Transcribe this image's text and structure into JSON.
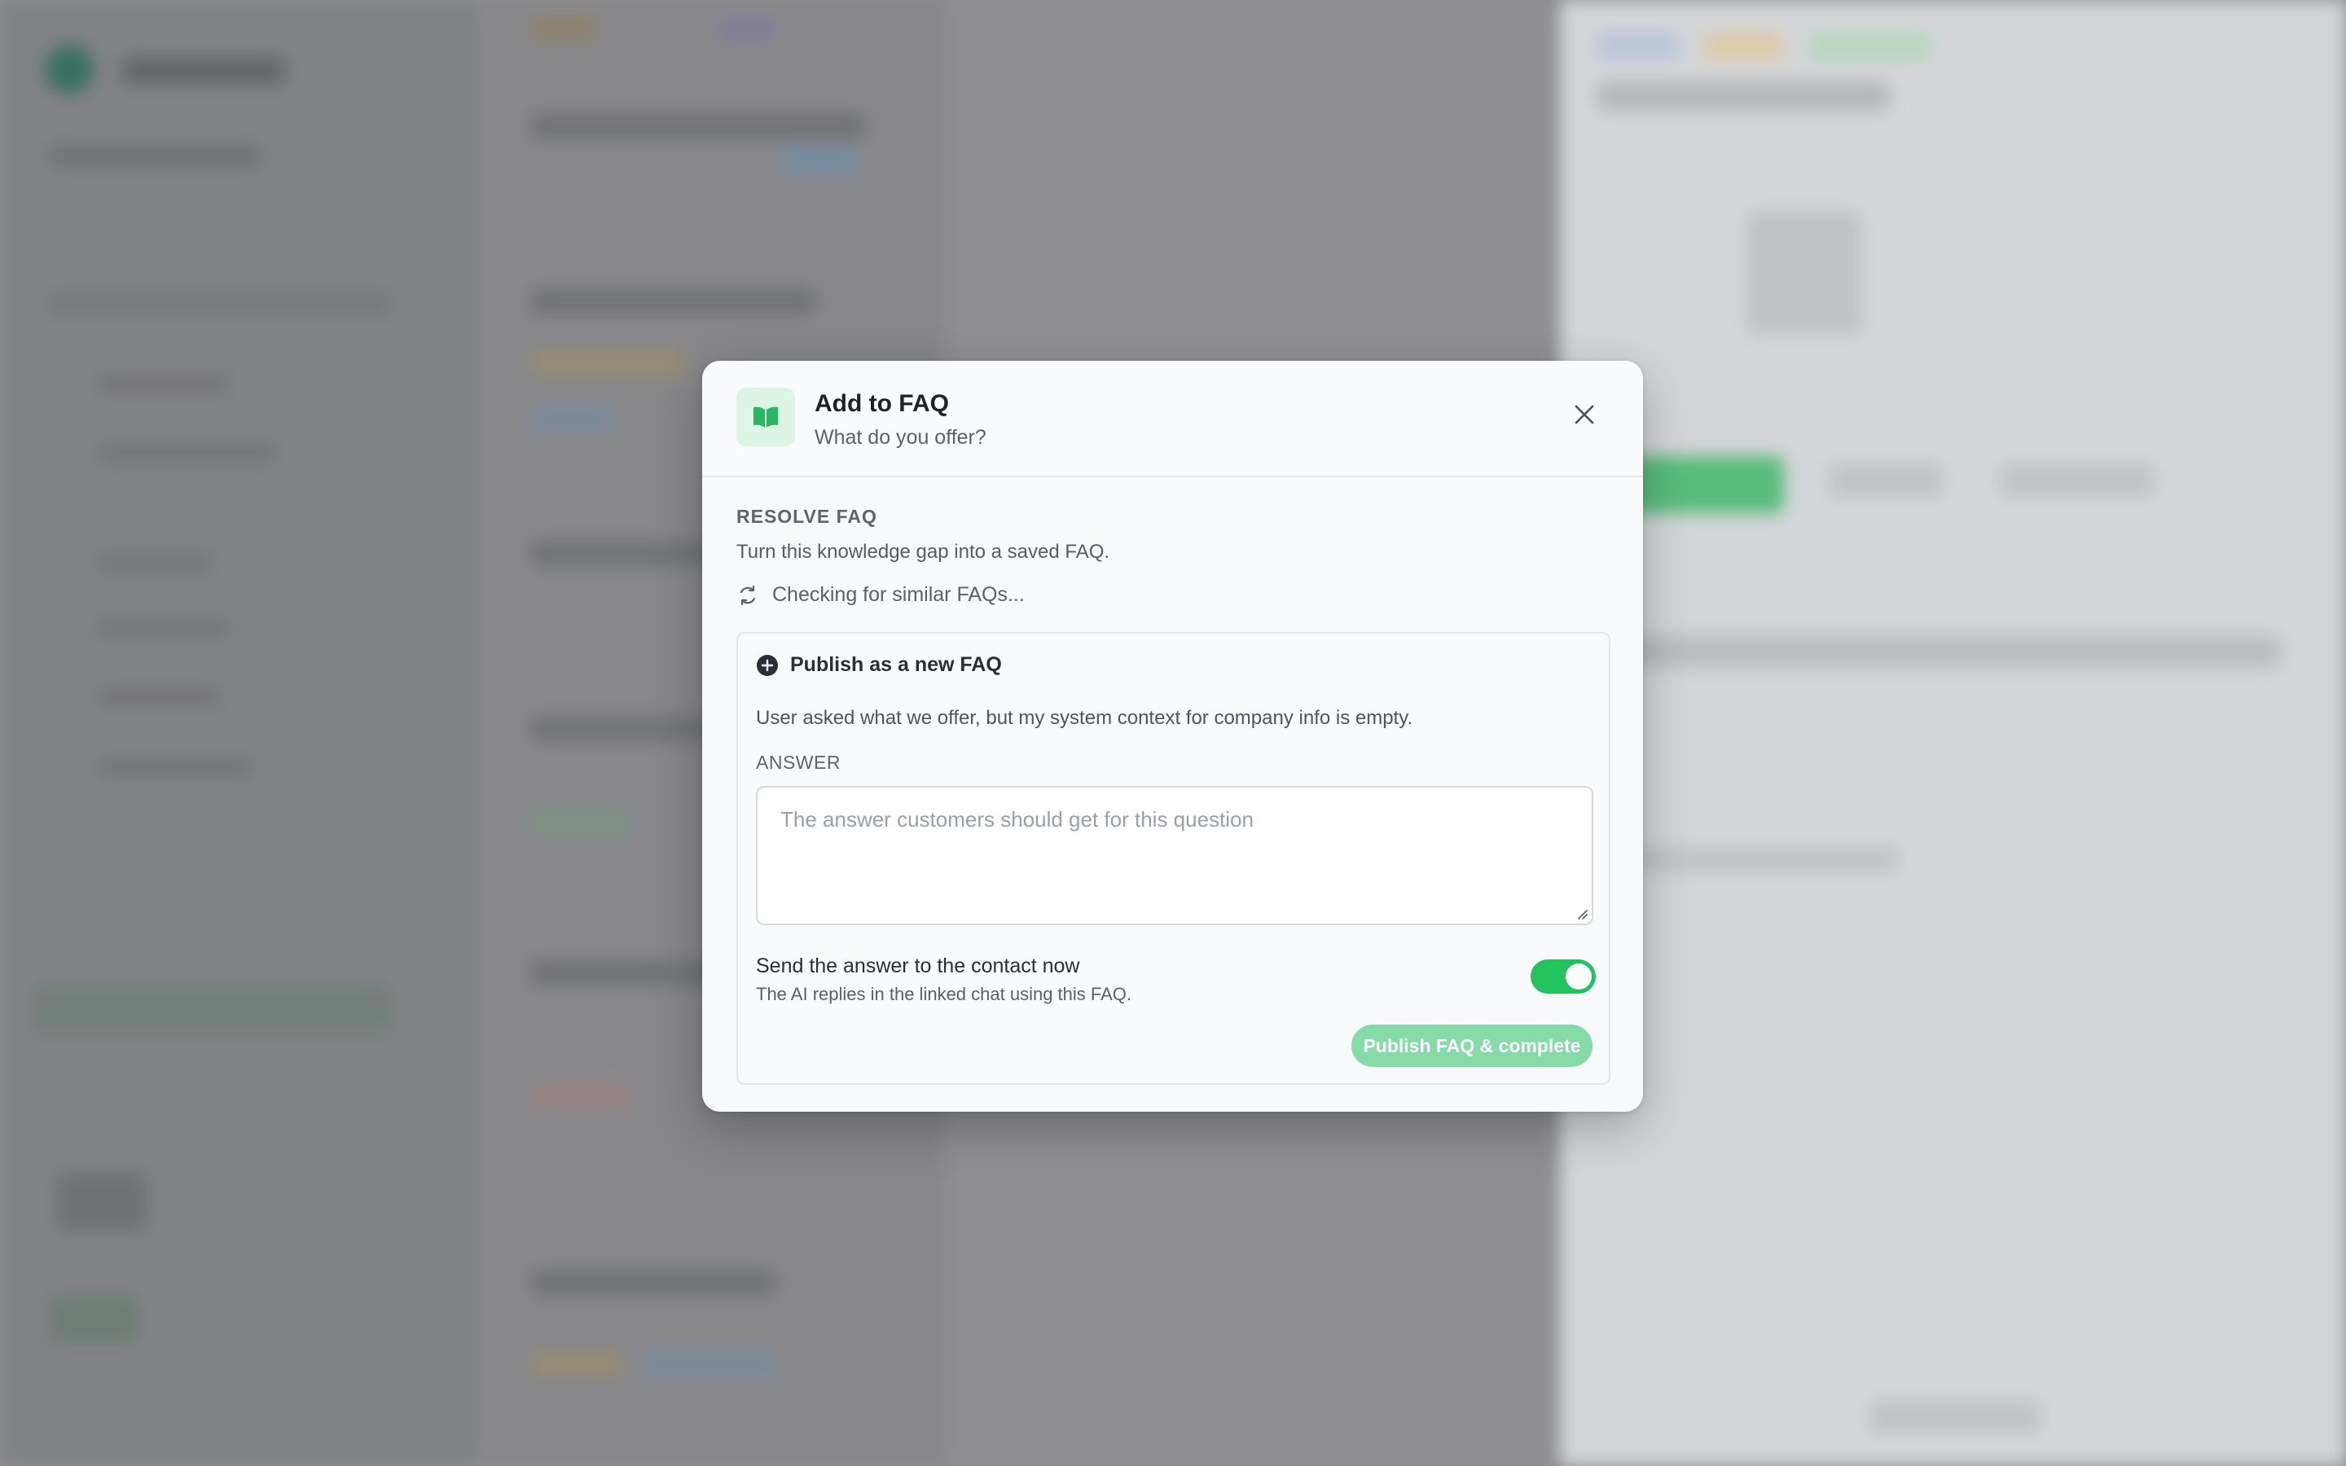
{
  "modal": {
    "title": "Add to FAQ",
    "subtitle": "What do you offer?",
    "icon": "book-open-icon",
    "close_icon": "close-icon"
  },
  "resolve": {
    "label": "RESOLVE FAQ",
    "description": "Turn this knowledge gap into a saved FAQ.",
    "checking_text": "Checking for similar FAQs..."
  },
  "card": {
    "title": "Publish as a new FAQ",
    "description": "User asked what we offer, but my system context for company info is empty.",
    "answer_label": "ANSWER",
    "answer_value": "",
    "answer_placeholder": "The answer customers should get for this question",
    "send_title": "Send the answer to the contact now",
    "send_subtitle": "The AI replies in the linked chat using this FAQ.",
    "send_toggle_on": true,
    "publish_label": "Publish FAQ & complete"
  },
  "colors": {
    "accent": "#22c35e",
    "accent_disabled": "#86dca6",
    "icon_bg": "#dcf5e5"
  }
}
